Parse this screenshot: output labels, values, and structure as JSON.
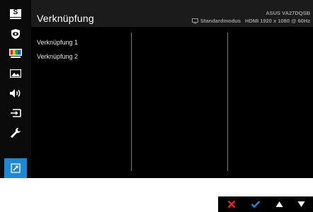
{
  "header": {
    "title": "Verknüpfung",
    "model": "ASUS VA27DQSB",
    "mode": "Standardmodus",
    "resolution": "HDMI 1920 x 1080 @ 60Hz"
  },
  "sidebar": {
    "items": [
      {
        "icon": "splendid-icon",
        "label": "S"
      },
      {
        "icon": "eye-care-icon"
      },
      {
        "icon": "color-icon"
      },
      {
        "icon": "image-icon"
      },
      {
        "icon": "sound-icon"
      },
      {
        "icon": "input-select-icon"
      },
      {
        "icon": "system-setup-icon"
      },
      {
        "icon": "shortcut-icon",
        "active": true
      }
    ]
  },
  "menu": {
    "items": [
      {
        "label": "Verknüpfung 1"
      },
      {
        "label": "Verknüpfung 2"
      }
    ]
  },
  "buttons": [
    {
      "icon": "close-icon"
    },
    {
      "icon": "check-icon"
    },
    {
      "icon": "up-arrow-icon"
    },
    {
      "icon": "down-arrow-icon"
    }
  ],
  "colors": {
    "accent": "#1e88d6",
    "close": "#e8232b",
    "check": "#1e88d6"
  }
}
